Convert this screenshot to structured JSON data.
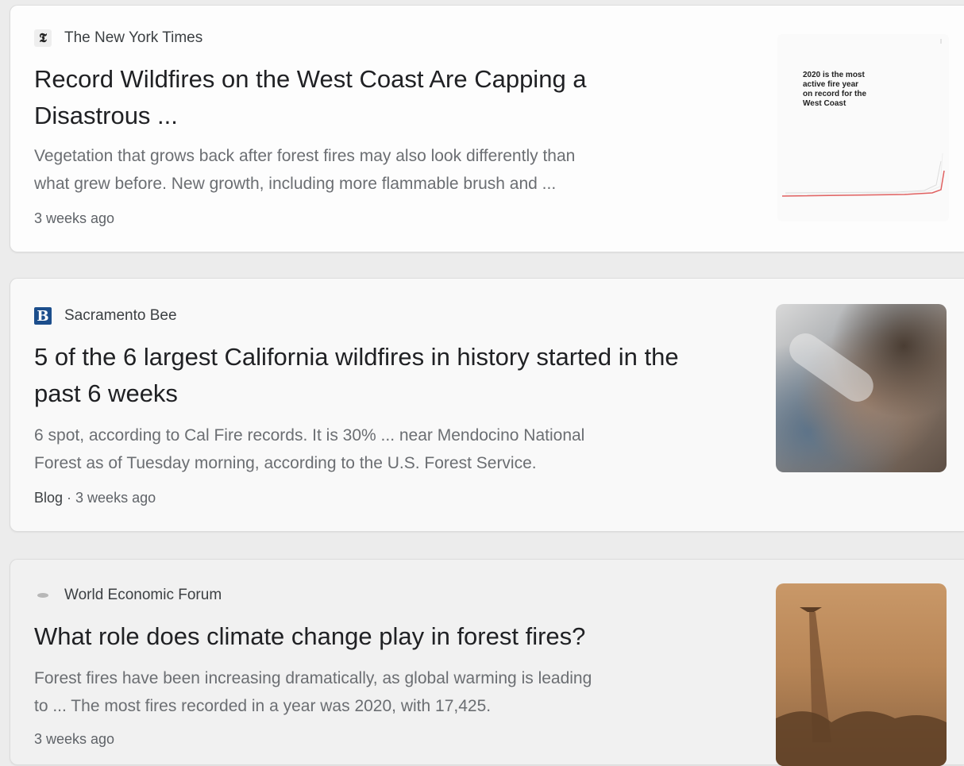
{
  "results": [
    {
      "source": "The New York Times",
      "title_line1": "Record Wildfires on the West Coast Are Capping a",
      "title_line2": "Disastrous ...",
      "snippet_line1": "Vegetation that grows back after forest fires may also look differently than",
      "snippet_line2": "what grew before. New growth, including more flammable brush and ...",
      "time": "3 weeks ago",
      "favicon_icon": "nyt-logo-icon",
      "thumb_lines": [
        "2020 is the most",
        "active fire year",
        "on record for the",
        "West Coast"
      ]
    },
    {
      "source": "Sacramento Bee",
      "title_line1": "5 of the 6 largest California wildfires in history started in the",
      "title_line2": "past 6 weeks",
      "snippet_line1": "6 spot, according to Cal Fire records. It is 30% ... near Mendocino National",
      "snippet_line2": "Forest as of Tuesday morning, according to the U.S. Forest Service.",
      "tag": "Blog",
      "separator": " · ",
      "time": "3 weeks ago",
      "favicon_icon": "sacbee-logo-icon",
      "favicon_letter": "B"
    },
    {
      "source": "World Economic Forum",
      "title_line1": "What role does climate change play in forest fires?",
      "snippet_line1": "Forest fires have been increasing dramatically, as global warming is leading",
      "snippet_line2": "to ... The most fires recorded in a year was 2020, with 17,425.",
      "time": "3 weeks ago",
      "favicon_icon": "wef-logo-icon"
    }
  ],
  "colors": {
    "title": "#202124",
    "snippet": "#6b6e72",
    "sacbee_blue": "#1c4e8c",
    "chart_line": "#e06060"
  }
}
